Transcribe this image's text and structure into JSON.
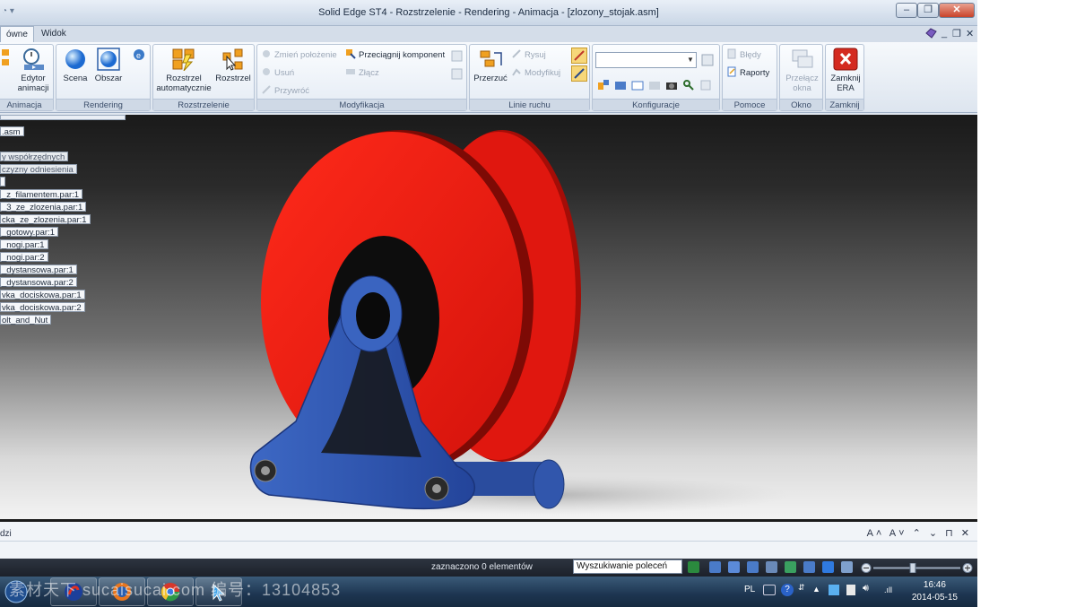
{
  "window": {
    "title": "Solid Edge ST4 - Rozstrzelenie - Rendering - Animacja - [zlozony_stojak.asm]",
    "controls": {
      "minimize": "–",
      "maximize": "❐",
      "close": "✕"
    }
  },
  "tabs": [
    {
      "label": "ówne",
      "active": true
    },
    {
      "label": "Widok",
      "active": false
    }
  ],
  "ribbon": {
    "groups": {
      "animacja": "Animacja",
      "rendering": "Rendering",
      "rozstrzelenie": "Rozstrzelenie",
      "modyfikacja": "Modyfikacja",
      "linie_ruchu": "Linie ruchu",
      "konfiguracje": "Konfiguracje",
      "pomoce": "Pomoce",
      "okno": "Okno",
      "zamknij": "Zamknij"
    },
    "buttons": {
      "edytor": "Edytor animacji",
      "scena": "Scena",
      "obszar": "Obszar",
      "rozstrzel_auto": "Rozstrzel automatycznie",
      "rozstrzel": "Rozstrzel",
      "zmien_polozenie": "Zmień położenie",
      "przeciagnij": "Przeciągnij komponent",
      "usun": "Usuń",
      "zlacz": "Złącz",
      "przywroc": "Przywróć",
      "rysuj": "Rysuj",
      "modyfikuj": "Modyfikuj",
      "przerzuc": "Przerzuć",
      "bledy": "Błędy",
      "raporty": "Raporty",
      "przelacz_okna": "Przełącz okna",
      "zamknij_era": "Zamknij ERA"
    },
    "config_combo_value": ""
  },
  "tree": [
    {
      "label": ".asm",
      "dim": false
    },
    {
      "label": "y współrzędnych",
      "dim": true
    },
    {
      "label": "czyzny odniesienia",
      "dim": true
    },
    {
      "label": "",
      "dim": false
    },
    {
      "label": "_z_filamentem.par:1",
      "dim": false
    },
    {
      "label": "_3_ze_zlozenia.par:1",
      "dim": false
    },
    {
      "label": "cka_ze_zlozenia.par:1",
      "dim": false
    },
    {
      "label": "_gotowy.par:1",
      "dim": false
    },
    {
      "label": "_nogi.par:1",
      "dim": false
    },
    {
      "label": "_nogi.par:2",
      "dim": false
    },
    {
      "label": "_dystansowa.par:1",
      "dim": false
    },
    {
      "label": "_dystansowa.par:2",
      "dim": false
    },
    {
      "label": "vka_dociskowa.par:1",
      "dim": false
    },
    {
      "label": "vka_dociskowa.par:2",
      "dim": false
    },
    {
      "label": "olt_and_Nut",
      "dim": false
    }
  ],
  "bottom_panel": {
    "title": "dzi",
    "controls": "A˄ A˅ ⌃ ⌄ ⊓ ✕"
  },
  "status": {
    "selection": "zaznaczono 0 elementów",
    "command_search": "Wyszukiwanie poleceń",
    "zoom_fraction": 0.45
  },
  "taskbar": {
    "watermark": "素材天下 sucaisucai.com   编号：13104853",
    "language": "PL",
    "time": "16:46",
    "date": "2014-05-15"
  },
  "colors": {
    "spool": "#e41b14",
    "stand": "#2f57b0",
    "ribbon": "#dfe6ef",
    "close_red": "#d42a20"
  }
}
